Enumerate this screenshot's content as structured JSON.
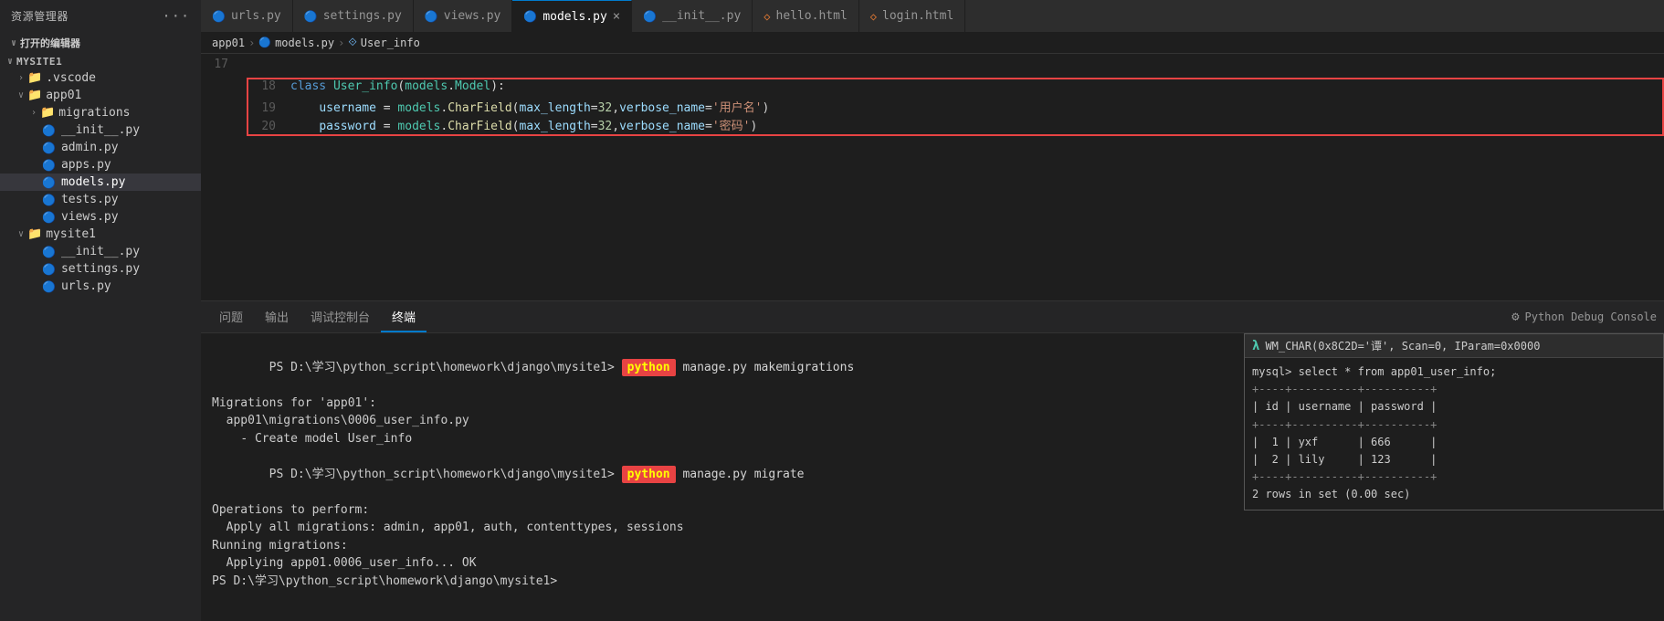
{
  "sidebar": {
    "header": "资源管理器",
    "open_editors_label": "打开的编辑器",
    "root_name": "MYSITE1",
    "items": [
      {
        "label": ".vscode",
        "type": "folder",
        "indent": 1,
        "expanded": false
      },
      {
        "label": "app01",
        "type": "folder",
        "indent": 1,
        "expanded": true
      },
      {
        "label": "migrations",
        "type": "folder",
        "indent": 2,
        "expanded": false
      },
      {
        "label": "__init__.py",
        "type": "py",
        "indent": 2
      },
      {
        "label": "admin.py",
        "type": "py",
        "indent": 2
      },
      {
        "label": "apps.py",
        "type": "py",
        "indent": 2
      },
      {
        "label": "models.py",
        "type": "py",
        "indent": 2,
        "active": true
      },
      {
        "label": "tests.py",
        "type": "py",
        "indent": 2
      },
      {
        "label": "views.py",
        "type": "py",
        "indent": 2
      },
      {
        "label": "mysite1",
        "type": "folder",
        "indent": 1,
        "expanded": true
      },
      {
        "label": "__init__.py",
        "type": "py",
        "indent": 2
      },
      {
        "label": "settings.py",
        "type": "py",
        "indent": 2
      },
      {
        "label": "urls.py",
        "type": "py",
        "indent": 2
      }
    ]
  },
  "tabs": [
    {
      "label": "urls.py",
      "type": "py",
      "active": false
    },
    {
      "label": "settings.py",
      "type": "py",
      "active": false
    },
    {
      "label": "views.py",
      "type": "py",
      "active": false
    },
    {
      "label": "models.py",
      "type": "py",
      "active": true,
      "closeable": true
    },
    {
      "label": "__init__.py",
      "type": "py",
      "active": false
    },
    {
      "label": "hello.html",
      "type": "html",
      "active": false
    },
    {
      "label": "login.html",
      "type": "html",
      "active": false
    }
  ],
  "breadcrumb": {
    "parts": [
      "app01",
      "models.py",
      "User_info"
    ]
  },
  "code": {
    "lines": [
      {
        "num": 17,
        "content": ""
      },
      {
        "num": 18,
        "content": "class User_info(models.Model):",
        "highlight": true
      },
      {
        "num": 19,
        "content": "    username = models.CharField(max_length=32,verbose_name='用户名')",
        "highlight": true
      },
      {
        "num": 20,
        "content": "    password = models.CharField(max_length=32,verbose_name='密码')",
        "highlight": true
      }
    ]
  },
  "panel": {
    "tabs": [
      "问题",
      "输出",
      "调试控制台",
      "终端"
    ],
    "active_tab": "终端",
    "right_label": "Python Debug Console"
  },
  "terminal": {
    "lines": [
      {
        "type": "cmd",
        "prompt": "PS D:\\学习\\python_script\\homework\\django\\mysite1> ",
        "cmd": "python",
        "rest": " manage.py makemigrations"
      },
      {
        "type": "text",
        "text": "Migrations for 'app01':"
      },
      {
        "type": "text",
        "text": "  app01\\migrations\\0006_user_info.py"
      },
      {
        "type": "text",
        "text": "    - Create model User_info"
      },
      {
        "type": "cmd",
        "prompt": "PS D:\\学习\\python_script\\homework\\django\\mysite1> ",
        "cmd": "python",
        "rest": " manage.py migrate"
      },
      {
        "type": "text",
        "text": "Operations to perform:"
      },
      {
        "type": "text",
        "text": "  Apply all migrations: admin, app01, auth, contenttypes, sessions"
      },
      {
        "type": "text",
        "text": "Running migrations:"
      },
      {
        "type": "text",
        "text": "  Applying app01.0006_user_info... OK"
      },
      {
        "type": "text",
        "text": "PS D:\\学习\\python_script\\homework\\django\\mysite1>"
      }
    ]
  },
  "mysql_popup": {
    "header": "WM_CHAR(0x8C2D='谭', Scan=0, IParam=0x0000",
    "lines": [
      "mysql> select * from app01_user_info;",
      "+----+----------+----------+",
      "| id | username | password |",
      "+----+----------+----------+",
      "|  1 | yxf      | 666      |",
      "|  2 | lily     | 123      |",
      "+----+----------+----------+",
      "2 rows in set (0.00 sec)"
    ]
  }
}
